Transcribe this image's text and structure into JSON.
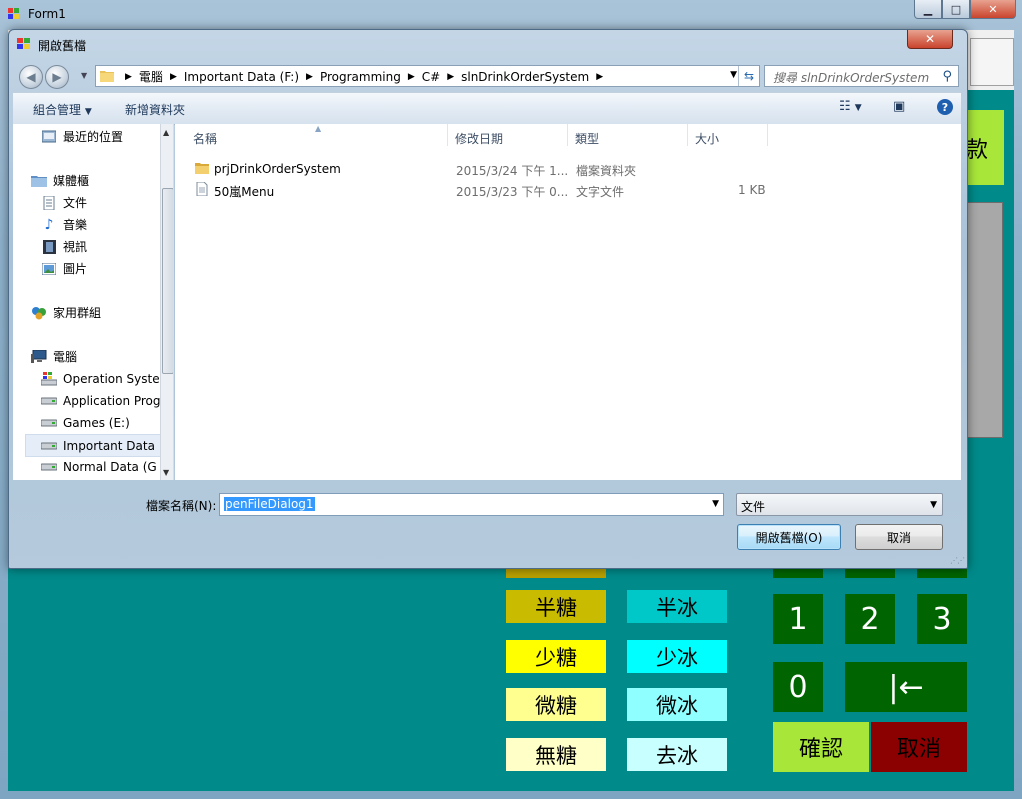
{
  "form": {
    "title": "Form1",
    "pay_label": "款",
    "sugar": [
      "半糖",
      "少糖",
      "微糖",
      "無糖"
    ],
    "sugar_colors": [
      "#c8bb00",
      "#ffff00",
      "#ffff90",
      "#ffffc8"
    ],
    "ice": [
      "半冰",
      "少冰",
      "微冰",
      "去冰"
    ],
    "ice_colors": [
      "#00c8c8",
      "#00ffff",
      "#90ffff",
      "#c8ffff"
    ],
    "numpad": {
      "n1": "1",
      "n2": "2",
      "n3": "3",
      "n0": "0",
      "back": "|←"
    },
    "confirm_label": "確認",
    "cancel_label": "取消",
    "confirm_color": "#a8e63a",
    "cancel_color": "#8b0000"
  },
  "dialog": {
    "title": "開啟舊檔",
    "breadcrumb": [
      "電腦",
      "Important Data (F:)",
      "Programming",
      "C#",
      "slnDrinkOrderSystem"
    ],
    "search_placeholder": "搜尋 slnDrinkOrderSystem",
    "toolbar": {
      "organize": "組合管理",
      "new_folder": "新增資料夾"
    },
    "nav_items": [
      {
        "label": "最近的位置",
        "icon": "recent-places-icon"
      },
      {
        "label": "媒體櫃",
        "icon": "libraries-icon"
      },
      {
        "label": "文件",
        "icon": "documents-icon"
      },
      {
        "label": "音樂",
        "icon": "music-icon"
      },
      {
        "label": "視訊",
        "icon": "videos-icon"
      },
      {
        "label": "圖片",
        "icon": "pictures-icon"
      },
      {
        "label": "家用群組",
        "icon": "homegroup-icon"
      },
      {
        "label": "電腦",
        "icon": "computer-icon"
      },
      {
        "label": "Operation Syste",
        "icon": "windows-drive-icon"
      },
      {
        "label": "Application Prog",
        "icon": "drive-icon"
      },
      {
        "label": "Games (E:)",
        "icon": "drive-icon"
      },
      {
        "label": "Important Data",
        "icon": "drive-icon"
      },
      {
        "label": "Normal Data (G",
        "icon": "drive-icon"
      }
    ],
    "columns": {
      "name": "名稱",
      "date": "修改日期",
      "type": "類型",
      "size": "大小"
    },
    "files": [
      {
        "name": "prjDrinkOrderSystem",
        "date": "2015/3/24 下午 1...",
        "type": "檔案資料夾",
        "size": "",
        "icon": "folder-icon"
      },
      {
        "name": "50嵐Menu",
        "date": "2015/3/23 下午 0...",
        "type": "文字文件",
        "size": "1 KB",
        "icon": "text-file-icon"
      }
    ],
    "filename_label": "檔案名稱(N):",
    "filename_value": "penFileDialog1",
    "filetype_value": "文件",
    "open_button": "開啟舊檔(O)",
    "cancel_button": "取消"
  }
}
